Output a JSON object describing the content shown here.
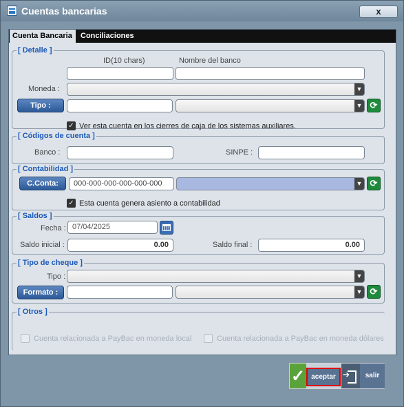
{
  "window": {
    "title": "Cuentas bancarias",
    "close_label": "x"
  },
  "tabs": [
    {
      "label": "Cuenta Bancaria",
      "active": true
    },
    {
      "label": "Conciliaciones",
      "active": false
    }
  ],
  "detalle": {
    "legend": "[ Detalle ]",
    "id_label": "ID(10 chars)",
    "nombre_label": "Nombre del banco",
    "id_value": "",
    "nombre_value": "",
    "moneda_label": "Moneda :",
    "moneda_value": "",
    "tipo_button": "Tipo :",
    "tipo_value": "",
    "tipo_select": "",
    "checkbox_label": "Ver esta cuenta en los cierres de caja de los sistemas auxiliares.",
    "checkbox_checked": true
  },
  "codigos": {
    "legend": "[ Códigos de cuenta ]",
    "banco_label": "Banco :",
    "banco_value": "",
    "sinpe_label": "SINPE :",
    "sinpe_value": ""
  },
  "contabilidad": {
    "legend": "[ Contabilidad ]",
    "cconta_button": "C.Conta:",
    "cconta_value": "000-000-000-000-000-000",
    "cconta_select": "",
    "checkbox_label": "Esta cuenta genera asiento a contabilidad",
    "checkbox_checked": true
  },
  "saldos": {
    "legend": "[ Saldos ]",
    "fecha_label": "Fecha :",
    "fecha_value": "07/04/2025",
    "saldo_inicial_label": "Saldo inicial :",
    "saldo_inicial_value": "0.00",
    "saldo_final_label": "Saldo final :",
    "saldo_final_value": "0.00"
  },
  "cheque": {
    "legend": "[ Tipo de cheque ]",
    "tipo_label": "Tipo :",
    "tipo_value": "",
    "formato_button": "Formato :",
    "formato_value": "",
    "formato_select": ""
  },
  "otros": {
    "legend": "[ Otros ]",
    "check1_label": "Cuenta relacionada a PayBac en moneda local",
    "check2_label": "Cuenta relacionada a PayBac en moneda dólares"
  },
  "footer": {
    "accept_label": "aceptar",
    "exit_label": "salir"
  }
}
